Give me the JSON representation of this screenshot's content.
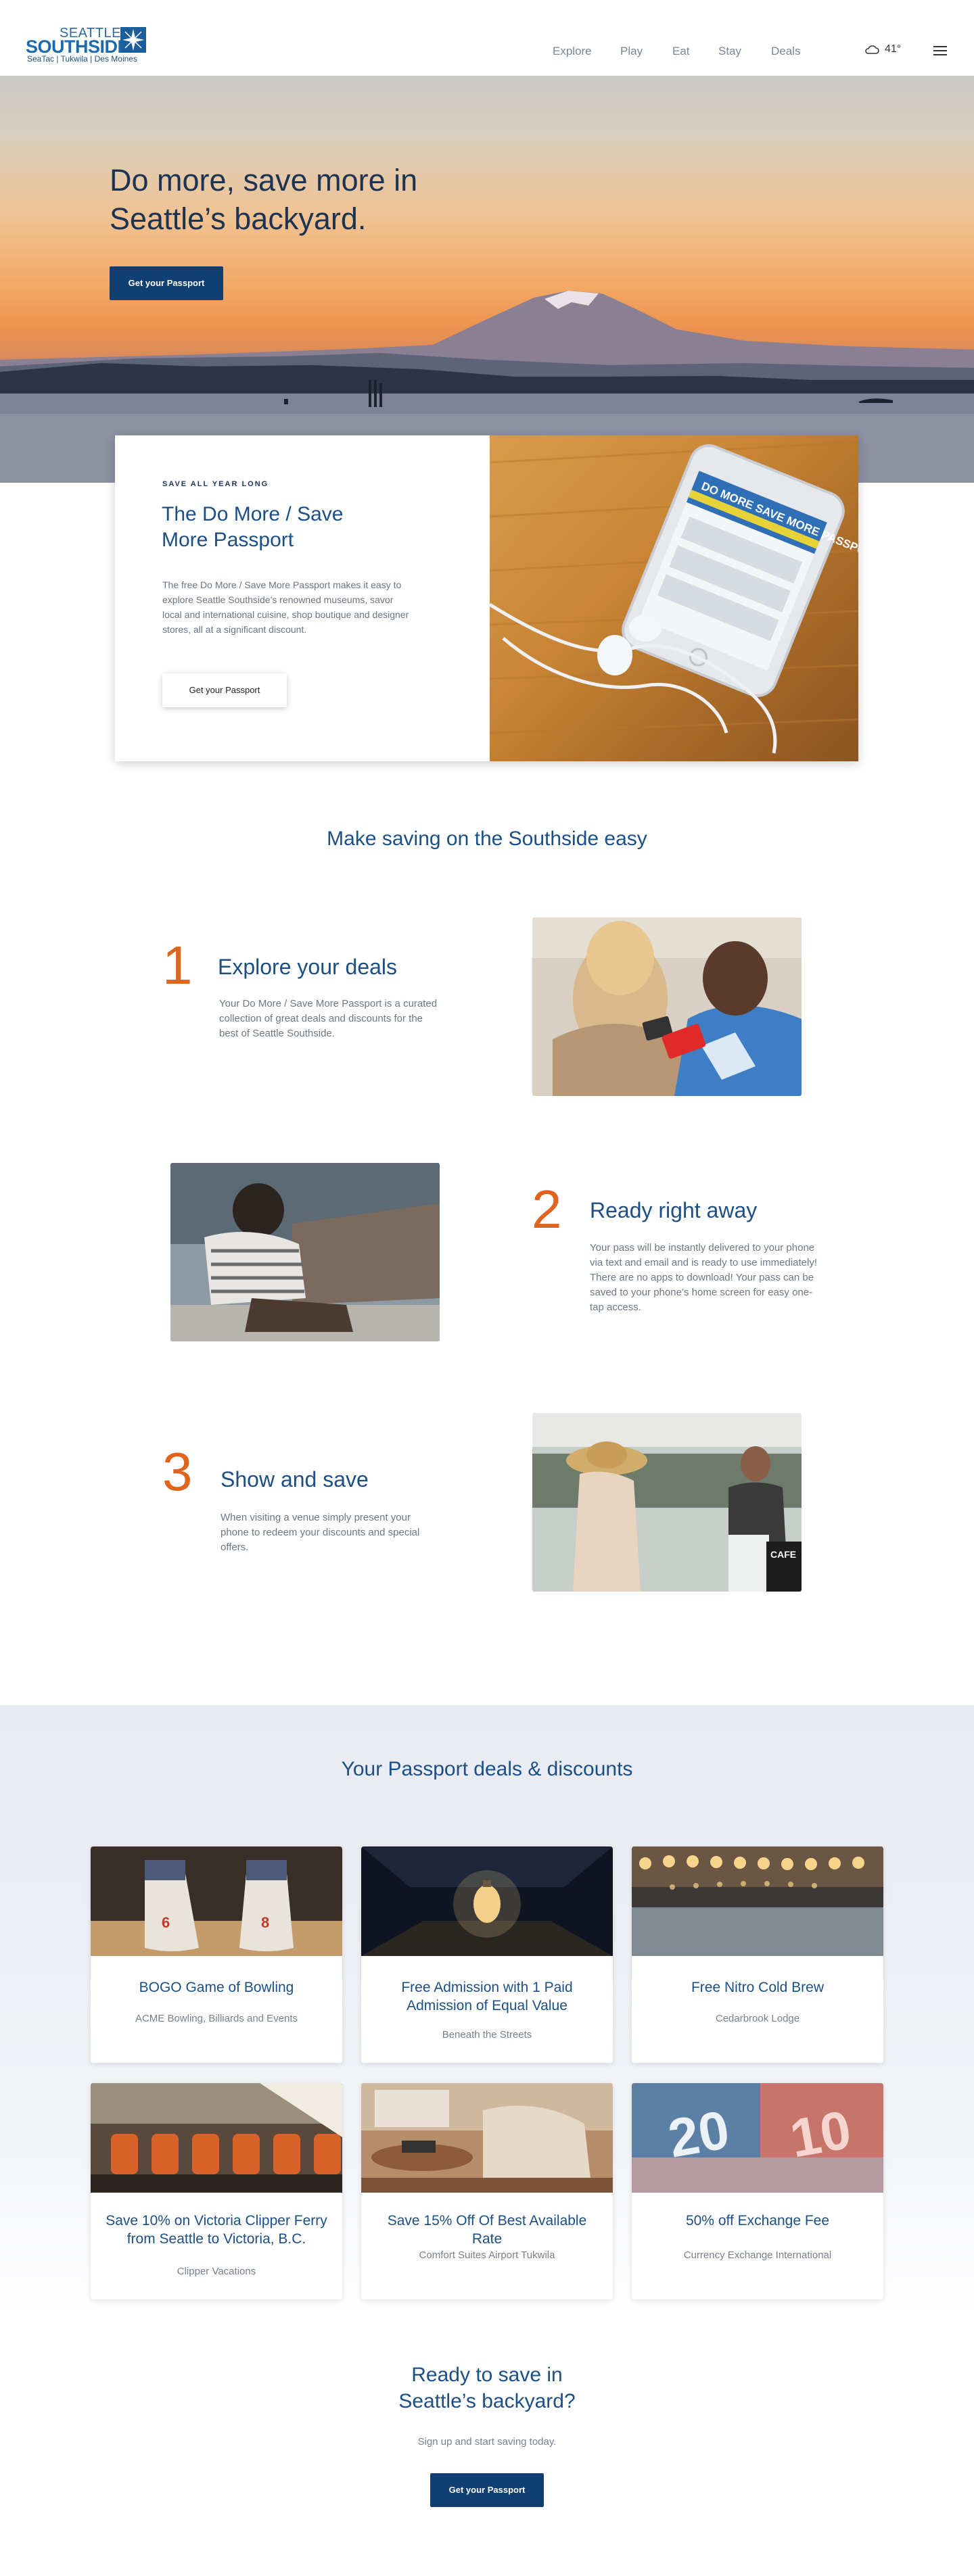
{
  "header": {
    "logo": {
      "line1": "SEATTLE",
      "line2": "SOUTHSIDE",
      "line3": "SeaTac | Tukwila | Des Moines"
    },
    "nav": [
      "Explore",
      "Play",
      "Eat",
      "Stay",
      "Deals"
    ],
    "weather": {
      "icon": "cloud-icon",
      "temp": "41°"
    },
    "menu_icon": "hamburger-menu-icon"
  },
  "hero": {
    "title": "Do more, save more in Seattle’s backyard.",
    "cta": "Get your Passport"
  },
  "intro": {
    "eyebrow": "SAVE ALL YEAR LONG",
    "title": "The Do More / Save More Passport",
    "text": "The free Do More / Save More Passport makes it easy to explore Seattle Southside’s renowned museums, savor local and international cuisine, shop boutique and designer stores, all at a significant discount.",
    "cta": "Get your Passport",
    "phone_screen_text": "DO MORE SAVE MORE PASSPORT"
  },
  "steps_section": {
    "title": "Make saving on the Southside easy",
    "steps": [
      {
        "num": "1",
        "title": "Explore your deals",
        "text": "Your Do More / Save More Passport is a curated collection of great deals and discounts for the best of Seattle Southside."
      },
      {
        "num": "2",
        "title": "Ready right away",
        "text": "Your pass will be instantly delivered to your phone via text and email and is ready to use immediately! There are no apps to download! Your pass can be saved to your phone’s home screen for easy one-tap access."
      },
      {
        "num": "3",
        "title": "Show and save",
        "text": "When visiting a venue simply present your phone to redeem your discounts and special offers."
      }
    ],
    "cafe_sign": "CAFE"
  },
  "deals": {
    "title": "Your Passport deals & discounts",
    "items": [
      {
        "title": "BOGO Game of Bowling",
        "vendor": "ACME Bowling, Billiards and Events"
      },
      {
        "title": "Free Admission with 1 Paid Admission of Equal Value",
        "vendor": "Beneath the Streets"
      },
      {
        "title": "Free Nitro Cold Brew",
        "vendor": "Cedarbrook Lodge"
      },
      {
        "title": "Save 10% on Victoria Clipper Ferry from Seattle to Victoria, B.C.",
        "vendor": "Clipper Vacations"
      },
      {
        "title": "Save 15% Off Of Best Available Rate",
        "vendor": "Comfort Suites Airport Tukwila"
      },
      {
        "title": "50% off Exchange Fee",
        "vendor": "Currency Exchange International"
      }
    ],
    "shoe_numbers": [
      "6",
      "8"
    ],
    "banknotes": [
      "20",
      "10"
    ]
  },
  "cta": {
    "title": "Ready to save in Seattle’s backyard?",
    "text": "Sign up and start saving today.",
    "button": "Get your Passport"
  },
  "colors": {
    "brand_blue": "#1c4f86",
    "button_navy": "#0f3f73",
    "accent_orange": "#e0631e"
  }
}
